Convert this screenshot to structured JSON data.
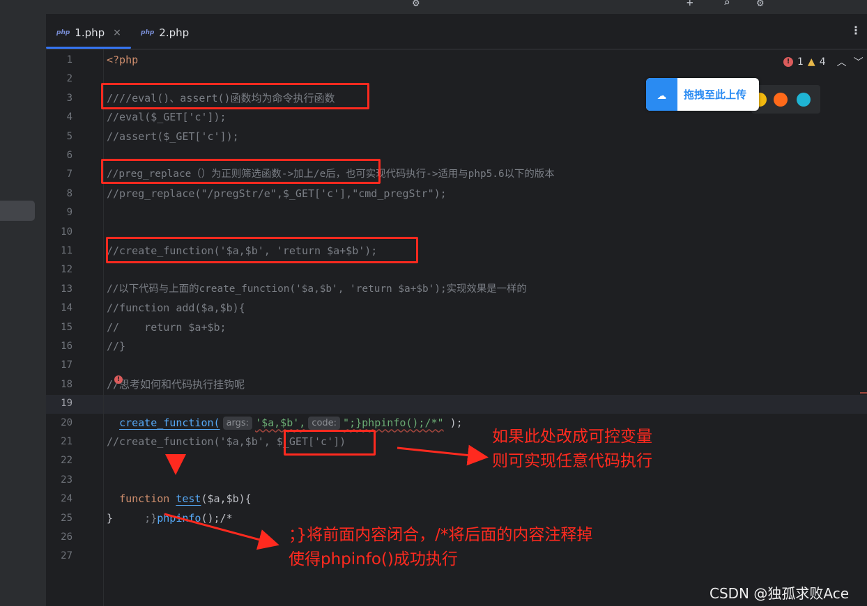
{
  "tabs": [
    {
      "icon": "php",
      "label": "1.php",
      "close": "×"
    },
    {
      "icon": "php",
      "label": "2.php"
    }
  ],
  "inspections": {
    "errors": "1",
    "warnings": "4"
  },
  "upload_widget": {
    "label": "拖拽至此上传"
  },
  "line_numbers": [
    "1",
    "2",
    "3",
    "4",
    "5",
    "6",
    "7",
    "8",
    "9",
    "10",
    "11",
    "12",
    "13",
    "14",
    "15",
    "16",
    "17",
    "18",
    "19",
    "20",
    "21",
    "22",
    "23",
    "24",
    "25",
    "26",
    "27"
  ],
  "code": {
    "l1": "<?php",
    "l3": "////eval()、assert()函数均为命令执行函数",
    "l4": "//eval($_GET['c']);",
    "l5": "//assert($_GET['c']);",
    "l7": "//preg_replace（）为正则筛选函数->加上/e后，也可实现代码执行->适用与php5.6以下的版本",
    "l8": "//preg_replace(\"/pregStr/e\",$_GET['c'],\"cmd_pregStr\");",
    "l11": "//create_function('$a,$b', 'return $a+$b');",
    "l13": "//以下代码与上面的create_function('$a,$b', 'return $a+$b');实现效果是一样的",
    "l14": "//function add($a,$b){",
    "l15": "//    return $a+$b;",
    "l16": "//}",
    "l18": "//思考如何和代码执行挂钩呢",
    "l19": {
      "fn": "create_function(",
      "hint_args": "args:",
      "arg1": "'$a,$b',",
      "hint_code": "code:",
      "arg2": "\";}phpinfo();/*\"",
      "end": " );"
    },
    "l21": "//create_function('$a,$b', $_GET['c'])",
    "l23": {
      "kw": "function",
      "name": "test",
      "params": "($a,$b){"
    },
    "l24": {
      "pre": "    ;}",
      "fn": "phpinfo",
      "post": "();/*"
    },
    "l25": "}"
  },
  "annotations": {
    "a1_line1": "如果此处改成可控变量",
    "a1_line2": "则可实现任意代码执行",
    "a2_line1": "；}将前面内容闭合，/*将后面的内容注释掉",
    "a2_line2": "使得phpinfo()成功执行"
  },
  "watermark": "CSDN @独孤求败Ace",
  "colors": {
    "accent": "#3574f0",
    "annotation": "#ff2a1f",
    "comment": "#7a7e85",
    "keyword": "#cf8e6d",
    "string": "#6aab73",
    "function": "#56a8f5"
  }
}
